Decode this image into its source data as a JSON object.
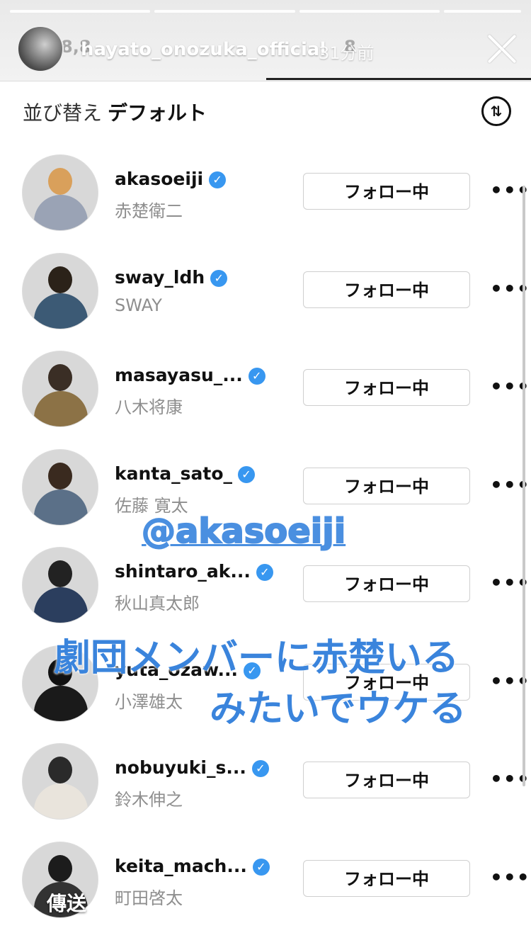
{
  "story": {
    "username": "hayato_onozuka_official",
    "time": "31分前",
    "ghost_left": "8,8",
    "ghost_right": "8"
  },
  "sort": {
    "label": "並び替え",
    "value": "デフォルト"
  },
  "button_label": "フォロー中",
  "verified_glyph": "✓",
  "more_glyph": "•••",
  "users": [
    {
      "username": "akasoeiji",
      "fullname": "赤楚衛二",
      "colors": [
        "#d9a05b",
        "#9aa3b5"
      ]
    },
    {
      "username": "sway_ldh",
      "fullname": "SWAY",
      "colors": [
        "#2b2219",
        "#3c5a75"
      ]
    },
    {
      "username": "masayasu_...",
      "fullname": "八木将康",
      "colors": [
        "#3a2e25",
        "#8c7246"
      ]
    },
    {
      "username": "kanta_sato_",
      "fullname": "佐藤 寛太",
      "colors": [
        "#3a2a1f",
        "#5b7088"
      ]
    },
    {
      "username": "shintaro_ak...",
      "fullname": "秋山真太郎",
      "colors": [
        "#222",
        "#2b3e5e"
      ]
    },
    {
      "username": "yuta_ozaw...",
      "fullname": "小澤雄太",
      "colors": [
        "#111",
        "#1a1a1a"
      ]
    },
    {
      "username": "nobuyuki_s...",
      "fullname": "鈴木伸之",
      "colors": [
        "#2a2a2a",
        "#e9e4dc"
      ]
    },
    {
      "username": "keita_mach...",
      "fullname": "町田啓太",
      "colors": [
        "#1c1c1c",
        "#333"
      ]
    }
  ],
  "overlay": {
    "mention": "@akasoeiji",
    "caption_line1": "劇団メンバーに赤楚いる",
    "caption_line2": "みたいでウケる",
    "send": "傳送"
  }
}
